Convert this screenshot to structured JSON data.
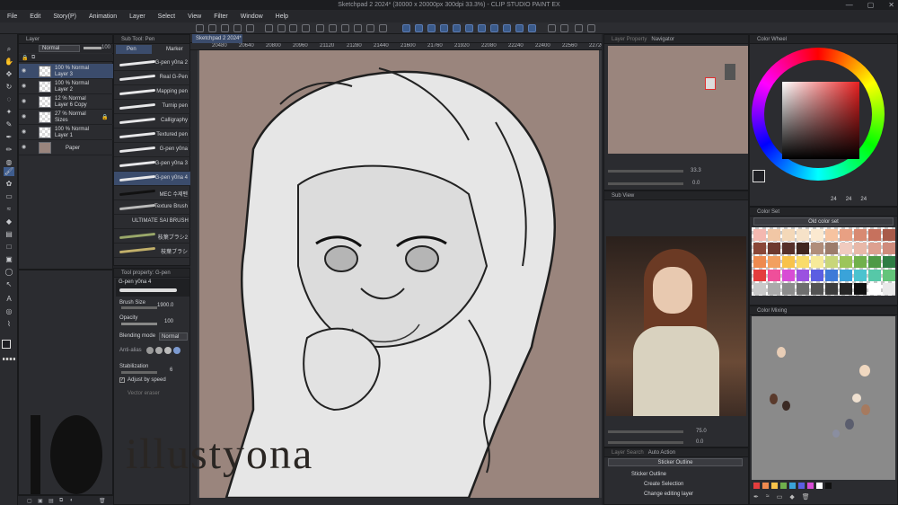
{
  "window": {
    "title": "Sketchpad 2 2024* (30000 x 20000px 300dpi 33.3%) - CLIP STUDIO PAINT EX",
    "minimize": "—",
    "maximize": "▢",
    "close": "✕"
  },
  "menu": [
    "File",
    "Edit",
    "Story(P)",
    "Animation",
    "Layer",
    "Select",
    "View",
    "Filter",
    "Window",
    "Help"
  ],
  "layer_panel": {
    "tab": "Layer",
    "blend": "Normal",
    "opacity": "100",
    "layers": [
      {
        "line1": "100 % Normal",
        "line2": "Layer 3",
        "selected": true,
        "lock": false
      },
      {
        "line1": "100 % Normal",
        "line2": "Layer 2",
        "selected": false,
        "lock": false
      },
      {
        "line1": "12 % Normal",
        "line2": "Layer 6 Copy",
        "selected": false,
        "lock": false
      },
      {
        "line1": "27 % Normal",
        "line2": "Sizes",
        "selected": false,
        "lock": true
      },
      {
        "line1": "100 % Normal",
        "line2": "Layer 1",
        "selected": false,
        "lock": false
      },
      {
        "line1": "",
        "line2": "Paper",
        "selected": false,
        "lock": false
      }
    ]
  },
  "subtool_panel": {
    "tab": "Sub Tool: Pen",
    "tabs": [
      "Pen",
      "Marker"
    ],
    "brushes": [
      {
        "label": "G-pen y0na 2",
        "sel": false
      },
      {
        "label": "Real G-Pen",
        "sel": false
      },
      {
        "label": "Mapping pen",
        "sel": false
      },
      {
        "label": "Turnip pen",
        "sel": false
      },
      {
        "label": "Calligraphy",
        "sel": false
      },
      {
        "label": "Textured pen",
        "sel": false
      },
      {
        "label": "G-pen y0na",
        "sel": false
      },
      {
        "label": "G-pen y0na 3",
        "sel": false
      },
      {
        "label": "G-pen y0na 4",
        "sel": true
      },
      {
        "label": "MEC 수제펜",
        "sel": false
      },
      {
        "label": "Texture Brush",
        "sel": false
      },
      {
        "label": "ULTIMATE SAI BRUSH",
        "sel": false
      },
      {
        "label": "枝葉ブラシ2",
        "sel": false
      },
      {
        "label": "枝葉ブラシ",
        "sel": false
      }
    ]
  },
  "tool_property": {
    "tab": "Tool property: G-pen",
    "brush_name": "G-pen y0na 4",
    "brush_size_label": "Brush Size",
    "brush_size": "1900.0",
    "opacity_label": "Opacity",
    "opacity": "100",
    "blending_label": "Blending mode",
    "blending": "Normal",
    "antialias_label": "Anti-alias",
    "stabilization_label": "Stabilization",
    "stabilization": "6",
    "adjust_label": "Adjust by speed",
    "vector_label": "Vector eraser"
  },
  "canvas": {
    "tab": "Sketchpad 2 2024*",
    "ruler": [
      "20480",
      "20640",
      "20800",
      "20960",
      "21120",
      "21280",
      "21440",
      "21600",
      "21760",
      "21920",
      "22080",
      "22240",
      "22400",
      "22560",
      "22720"
    ],
    "bg_color": "#9a857d",
    "watermark": "illustyona"
  },
  "navigator": {
    "tabs": [
      "Layer Property",
      "Navigator"
    ],
    "zoom": "33.3",
    "rotation": "0.0"
  },
  "subview": {
    "tab": "Sub View",
    "zoom": "75.0",
    "rotation": "0.0"
  },
  "auto_action": {
    "tabs": [
      "Layer Search",
      "Auto Action"
    ],
    "set": "Sticker Outline",
    "items": [
      {
        "label": "Sticker Outline",
        "indent": 0
      },
      {
        "label": "Create Selection",
        "indent": 1
      },
      {
        "label": "Change editing layer",
        "indent": 1
      }
    ]
  },
  "color_wheel": {
    "tab": "Color Wheel",
    "main_color": "#1e1f24",
    "sub_color": "#f3e6d4",
    "rgb": [
      "24",
      "24",
      "24"
    ]
  },
  "color_set": {
    "tab": "Color Set",
    "name": "Old color set",
    "colors": [
      "#f4b8b0",
      "#f1c7a5",
      "#f4d8b8",
      "#f6e2c8",
      "#fbe9d0",
      "#f7c3a0",
      "#e8a083",
      "#d88a72",
      "#c6715d",
      "#a85b4a",
      "#8a4738",
      "#6e3a2f",
      "#56302a",
      "#40261f",
      "#b08d7a",
      "#9c7c6b",
      "#f0cbbf",
      "#e8b8a8",
      "#dda090",
      "#cf8b7c",
      "#ee8a4f",
      "#f2a060",
      "#f8c24a",
      "#f9dc6a",
      "#f7ea9a",
      "#c8d67a",
      "#9cc55a",
      "#70b04c",
      "#4e9a46",
      "#2f7d45",
      "#e43d3d",
      "#ef4f9a",
      "#d84cd5",
      "#9b52e0",
      "#5b5ee2",
      "#3e7ad8",
      "#3aa3d9",
      "#4bc3cf",
      "#56c8a8",
      "#64c47a",
      "#c9c9c9",
      "#aaaaaa",
      "#8c8c8c",
      "#6e6e6e",
      "#535353",
      "#3c3c3c",
      "#262626",
      "#111111",
      "#ffffff",
      "#e9e9e9"
    ]
  },
  "color_mixing": {
    "tab": "Color Mixing",
    "blobs": [
      {
        "color": "#e8cdb6"
      },
      {
        "color": "#f0d8c0"
      },
      {
        "color": "#5a3a2c"
      },
      {
        "color": "#3b2a24"
      },
      {
        "color": "#efe0d0"
      },
      {
        "color": "#5b5e6e"
      },
      {
        "color": "#8a8ea0"
      },
      {
        "color": "#a67a5f"
      }
    ]
  }
}
